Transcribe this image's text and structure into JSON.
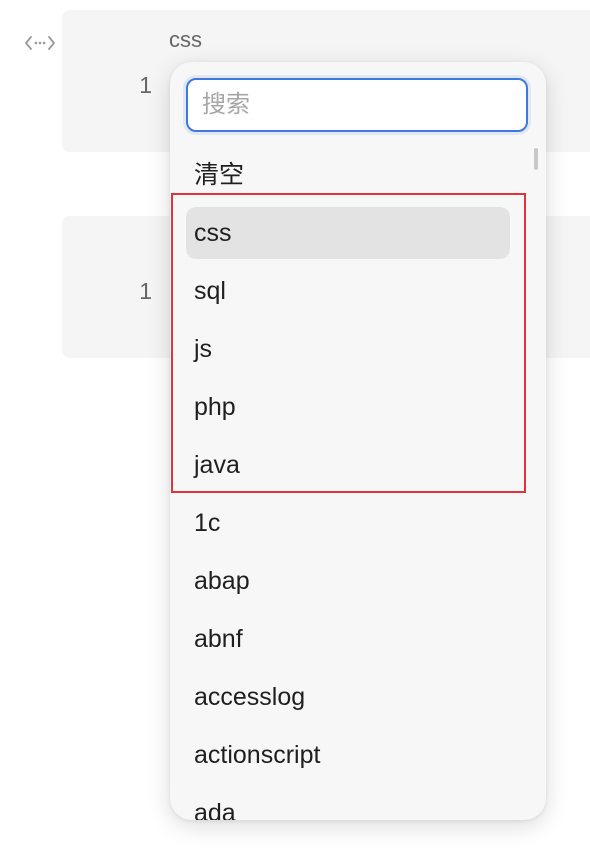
{
  "editor": {
    "blocks": [
      {
        "language_label": "css",
        "line_number": "1"
      },
      {
        "line_number": "1"
      }
    ]
  },
  "dropdown": {
    "search_placeholder": "搜索",
    "options": [
      "清空",
      "css",
      "sql",
      "js",
      "php",
      "java",
      "1c",
      "abap",
      "abnf",
      "accesslog",
      "actionscript",
      "ada"
    ],
    "selected_option": "css"
  },
  "colors": {
    "accent": "#3f78e0",
    "highlight_border": "#e2323a",
    "selected_bg": "#e3e3e3",
    "code_block_bg": "#f5f5f5"
  },
  "icons": {
    "code": "code-brackets-icon"
  }
}
